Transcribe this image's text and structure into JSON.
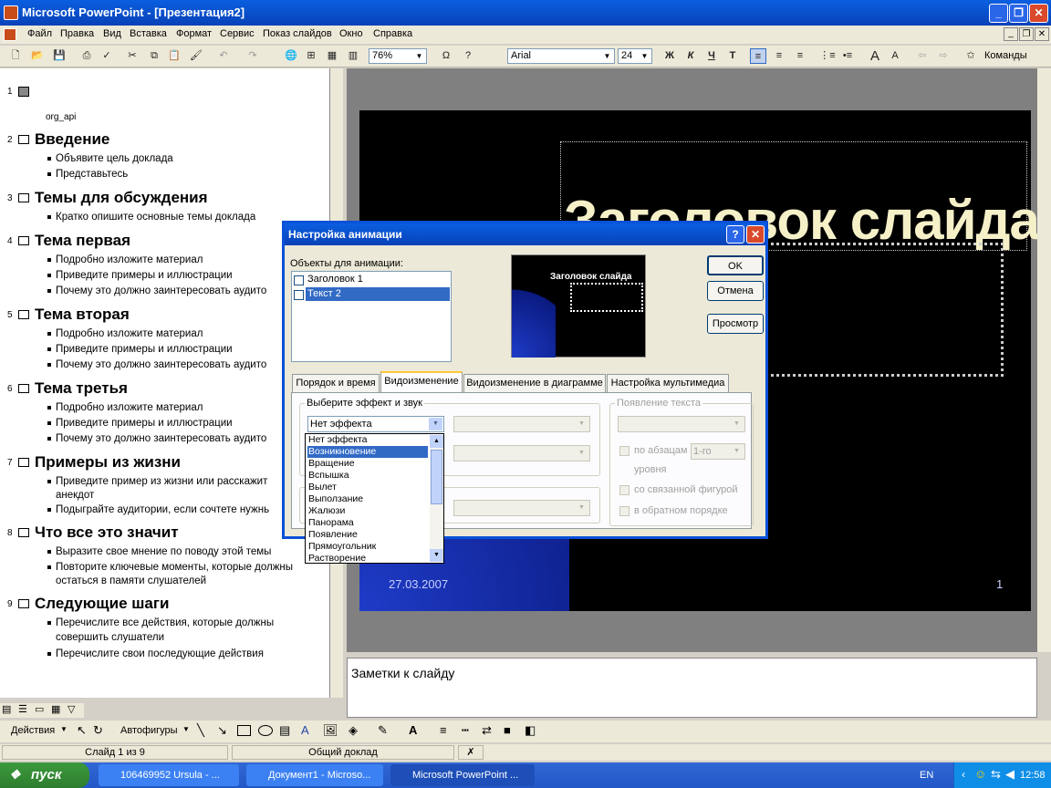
{
  "app": {
    "title": "Microsoft PowerPoint - [Презентация2]"
  },
  "menu": [
    "Файл",
    "Правка",
    "Вид",
    "Вставка",
    "Формат",
    "Сервис",
    "Показ слайдов",
    "Окно",
    "Справка"
  ],
  "toolbar": {
    "zoom": "76%",
    "font": "Arial",
    "size": "24",
    "bold": "Ж",
    "italic": "К",
    "underline": "Ч",
    "shadow": "Т",
    "commands": "Команды"
  },
  "outline": {
    "slide1_caption": "org_api",
    "slides": [
      {
        "num": "2",
        "title": "Введение",
        "bullets": [
          "Объявите цель доклада",
          "Представьтесь"
        ]
      },
      {
        "num": "3",
        "title": "Темы для обсуждения",
        "bullets": [
          "Кратко опишите основные темы доклада"
        ]
      },
      {
        "num": "4",
        "title": "Тема первая",
        "bullets": [
          "Подробно изложите материал",
          "Приведите примеры и иллюстрации",
          "Почему это должно заинтересовать аудито"
        ]
      },
      {
        "num": "5",
        "title": "Тема вторая",
        "bullets": [
          "Подробно изложите материал",
          "Приведите примеры и иллюстрации",
          "Почему это должно заинтересовать аудито"
        ]
      },
      {
        "num": "6",
        "title": "Тема третья",
        "bullets": [
          "Подробно изложите материал",
          "Приведите примеры и иллюстрации",
          "Почему это должно заинтересовать аудито"
        ]
      },
      {
        "num": "7",
        "title": "Примеры из жизни",
        "bullets": [
          "Приведите пример из жизни или расскажит",
          "анекдот",
          "Подыграйте аудитории, если сочтете нужнь"
        ]
      },
      {
        "num": "8",
        "title": "Что все это значит",
        "bullets": [
          "Выразите свое мнение по поводу этой темы",
          "Повторите ключевые моменты, которые должны",
          "остаться в памяти слушателей"
        ]
      },
      {
        "num": "9",
        "title": "Следующие шаги",
        "bullets": [
          "Перечислите все действия, которые должны",
          "совершить слушатели",
          "Перечислите свои последующие действия"
        ]
      }
    ]
  },
  "slide": {
    "title": "Заголовок слайда",
    "date": "27.03.2007",
    "page": "1"
  },
  "notes": {
    "text": "Заметки к слайду"
  },
  "drawing": {
    "actions": "Действия",
    "autoshapes": "Автофигуры"
  },
  "status": {
    "slide": "Слайд 1 из 9",
    "design": "Общий доклад"
  },
  "dialog": {
    "title": "Настройка анимации",
    "objects_label": "Объекты для анимации:",
    "objects": [
      {
        "label": "Заголовок 1",
        "selected": false
      },
      {
        "label": "Текст 2",
        "selected": true
      }
    ],
    "preview_title": "Заголовок слайда",
    "buttons": {
      "ok": "OK",
      "cancel": "Отмена",
      "preview": "Просмотр"
    },
    "tabs": [
      "Порядок и время",
      "Видоизменение",
      "Видоизменение в диаграмме",
      "Настройка мультимедиа"
    ],
    "selected_tab": "Видоизменение",
    "effect_group": "Выберите эффект и звук",
    "effect_value": "Нет эффекта",
    "text_group": "Появление текста",
    "by_paragraph": "по абзацам",
    "level_value": "1-го",
    "level_suffix": "уровня",
    "attached_shape": "со связанной фигурой",
    "reverse_order": "в обратном порядке",
    "effect_options": [
      "Нет эффекта",
      "Возникновение",
      "Вращение",
      "Вспышка",
      "Вылет",
      "Выползание",
      "Жалюзи",
      "Панорама",
      "Появление",
      "Прямоугольник",
      "Растворение"
    ],
    "effect_highlight": "Возникновение"
  },
  "taskbar": {
    "start": "пуск",
    "tasks": [
      "106469952 Ursula - ...",
      "Документ1 - Microso...",
      "Microsoft PowerPoint ..."
    ],
    "lang": "EN",
    "time": "12:58"
  },
  "colors": {
    "accent": "#0a51d8",
    "slide_title": "#f5f0c8",
    "selection": "#316ac5"
  }
}
